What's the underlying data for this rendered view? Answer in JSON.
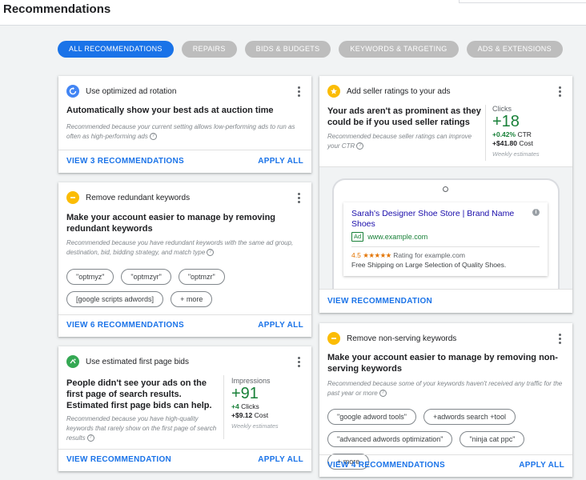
{
  "header": {
    "title": "Recommendations"
  },
  "filters": [
    {
      "label": "ALL RECOMMENDATIONS",
      "active": true
    },
    {
      "label": "REPAIRS"
    },
    {
      "label": "BIDS & BUDGETS"
    },
    {
      "label": "KEYWORDS & TARGETING"
    },
    {
      "label": "ADS & EXTENSIONS"
    }
  ],
  "colors": {
    "accent": "#1a73e8",
    "positive": "#188038",
    "warning": "#fbbc04"
  },
  "cards": {
    "ad_rotation": {
      "icon": "rotation-icon",
      "label": "Use optimized ad rotation",
      "headline": "Automatically show your best ads at auction time",
      "reason": "Recommended because your current setting allows low-performing ads to run as often as high-performing ads",
      "view_link": "VIEW 3 RECOMMENDATIONS",
      "apply_link": "APPLY ALL"
    },
    "redundant_keywords": {
      "icon": "minus-icon",
      "label": "Remove redundant keywords",
      "headline": "Make your account easier to manage by removing redundant keywords",
      "reason": "Recommended because you have redundant keywords with the same ad group, destination, bid, bidding strategy, and match type",
      "keywords": [
        "\"optmyz\"",
        "\"optmzyr\"",
        "\"optmzr\"",
        "[google scripts adwords]",
        "+ more"
      ],
      "view_link": "VIEW 6 RECOMMENDATIONS",
      "apply_link": "APPLY ALL"
    },
    "first_page_bids": {
      "icon": "bid-icon",
      "label": "Use estimated first page bids",
      "headline": "People didn't see your ads on the first page of search results. Estimated first page bids can help.",
      "reason": "Recommended because you have high-quality keywords that rarely show on the first page of search results",
      "stats": {
        "metric": "Impressions",
        "value": "+91",
        "line1_value": "+4",
        "line1_label": "Clicks",
        "line2_value": "+$9.12",
        "line2_label": "Cost",
        "note": "Weekly estimates"
      },
      "view_link": "VIEW RECOMMENDATION",
      "apply_link": "APPLY ALL"
    },
    "seller_ratings": {
      "icon": "star-icon",
      "label": "Add seller ratings to your ads",
      "headline": "Your ads aren't as prominent as they could be if you used seller ratings",
      "reason": "Recommended because seller ratings can improve your CTR",
      "stats": {
        "metric": "Clicks",
        "value": "+18",
        "line1_value": "+0.42%",
        "line1_label": "CTR",
        "line2_value": "+$41.80",
        "line2_label": "Cost",
        "note": "Weekly estimates"
      },
      "ad_preview": {
        "title": "Sarah's Designer Shoe Store | Brand Name Shoes",
        "badge": "Ad",
        "url": "www.example.com",
        "rating_value": "4.5",
        "stars": "★★★★★",
        "rating_text": "Rating for example.com",
        "extension_text": "Free Shipping on Large Selection of Quality Shoes."
      },
      "view_link": "VIEW RECOMMENDATION"
    },
    "non_serving": {
      "icon": "minus-icon",
      "label": "Remove non-serving keywords",
      "headline": "Make your account easier to manage by removing non-serving keywords",
      "reason": "Recommended because some of your keywords haven't received any traffic for the past year or more",
      "keywords": [
        "\"google adword tools\"",
        "+adwords search +tool",
        "\"advanced adwords optimization\"",
        "\"ninja cat ppc\"",
        "+ more"
      ],
      "view_link": "VIEW 4 RECOMMENDATIONS",
      "apply_link": "APPLY ALL"
    }
  }
}
